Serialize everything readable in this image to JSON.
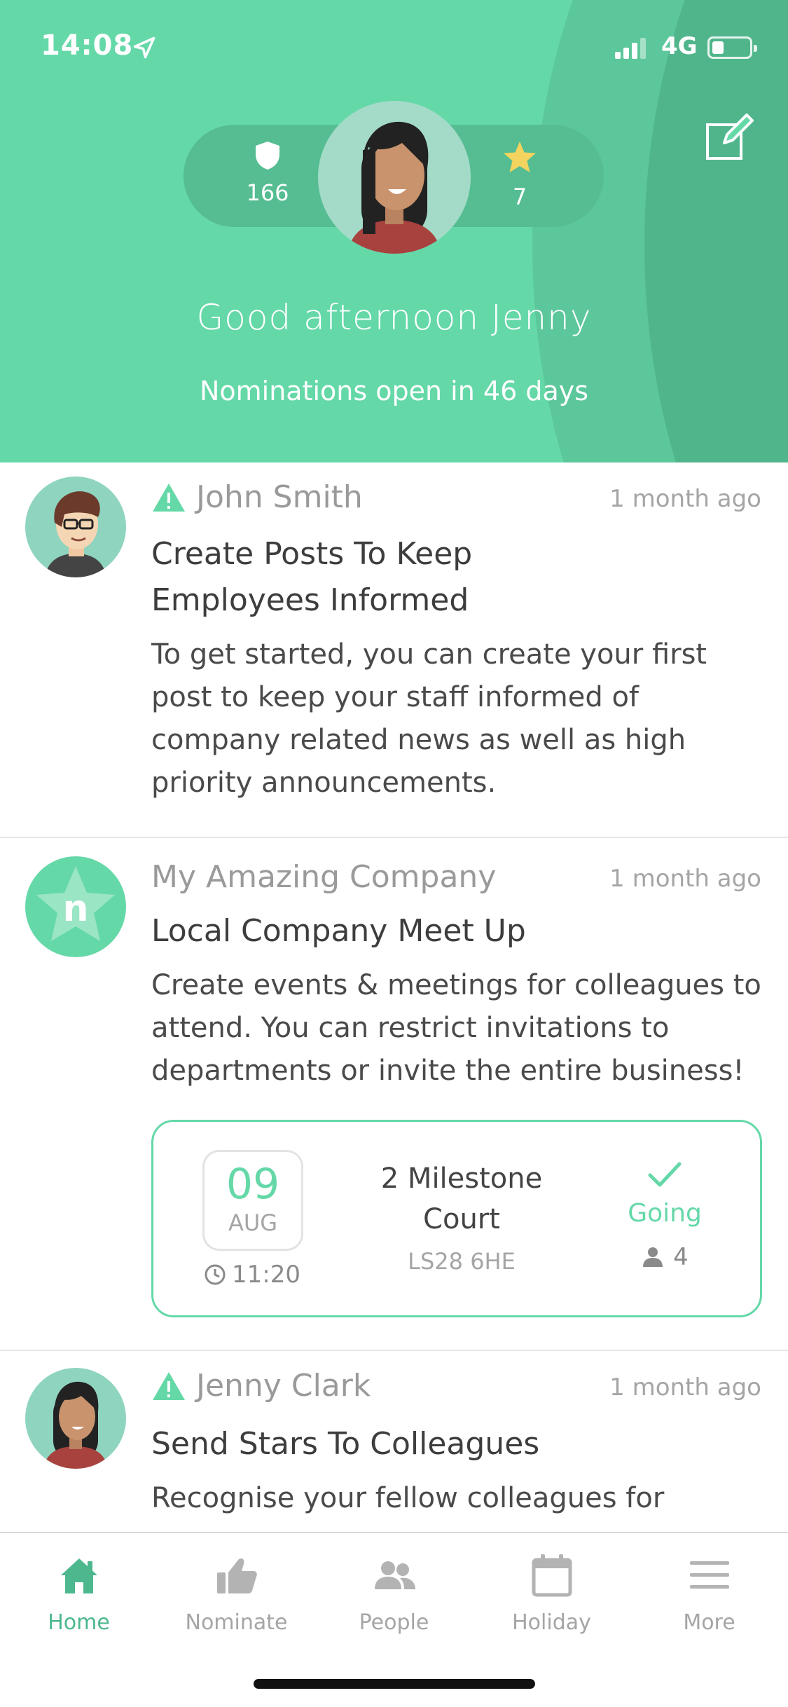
{
  "status_bar": {
    "time": "14:08",
    "network": "4G"
  },
  "header": {
    "shield_count": "166",
    "star_count": "7",
    "greeting": "Good afternoon Jenny",
    "nominations": "Nominations open in 46 days"
  },
  "feed": [
    {
      "author": "John Smith",
      "time": "1 month ago",
      "title": "Create Posts To Keep Employees Informed",
      "body": "To get started, you can create your first post to keep your staff informed of company related news as well as high priority announcements."
    },
    {
      "author": "My Amazing Company",
      "time": "1 month ago",
      "title": "Local Company Meet Up",
      "body": "Create events & meetings for colleagues to attend.  You can restrict invitations to departments or invite the entire business!",
      "event": {
        "day": "09",
        "month": "AUG",
        "time": "11:20",
        "venue": "2 Milestone Court",
        "postcode": "LS28 6HE",
        "status": "Going",
        "attendees": "4"
      }
    },
    {
      "author": "Jenny Clark",
      "time": "1 month ago",
      "title": "Send Stars To Colleagues",
      "body": "Recognise your fellow colleagues for"
    }
  ],
  "tabbar": {
    "home": "Home",
    "nominate": "Nominate",
    "people": "People",
    "holiday": "Holiday",
    "more": "More"
  },
  "colors": {
    "accent": "#65d8a8",
    "accent_dark": "#4db88e",
    "star": "#f4d35e"
  }
}
